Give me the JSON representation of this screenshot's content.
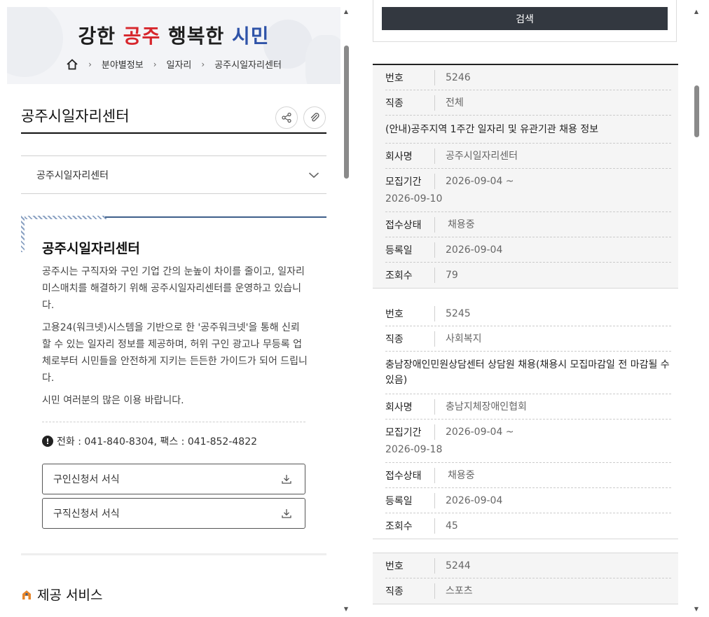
{
  "header": {
    "slogan_part1": "강한 ",
    "slogan_part2": "공주",
    "slogan_part3": " 행복한 ",
    "slogan_part4": "시민",
    "breadcrumb": [
      "분야별정보",
      "일자리",
      "공주시일자리센터"
    ]
  },
  "page": {
    "title": "공주시일자리센터",
    "selectbox_value": "공주시일자리센터"
  },
  "intro": {
    "title": "공주시일자리센터",
    "paragraphs": [
      "공주시는 구직자와 구인 기업 간의 눈높이 차이를 줄이고, 일자리 미스매치를 해결하기 위해 공주시일자리센터를 운영하고 있습니다.",
      "고용24(워크넷)시스템을 기반으로 한 '공주워크넷'을 통해 신뢰할 수 있는 일자리 정보를 제공하며, 허위 구인 광고나 무등록 업체로부터 시민들을 안전하게 지키는 든든한 가이드가 되어 드립니다.",
      "시민 여러분의 많은 이용 바랍니다."
    ],
    "contact": "전화 : 041-840-8304, 팩스 : 041-852-4822"
  },
  "downloads": [
    {
      "label": "구인신청서 서식"
    },
    {
      "label": "구직신청서 서식"
    }
  ],
  "services": {
    "title": "제공 서비스"
  },
  "search": {
    "button_label": "검색"
  },
  "labels": {
    "number": "번호",
    "category": "직종",
    "company": "회사명",
    "period": "모집기간",
    "status": "접수상태",
    "registered": "등록일",
    "views": "조회수"
  },
  "jobs": [
    {
      "number": "5246",
      "category": "전체",
      "title": "(안내)공주지역 1주간 일자리 및 유관기관 채용 정보",
      "company": "공주시일자리센터",
      "period_start": "2026-09-04 ~",
      "period_end": "2026-09-10",
      "status": "채용중",
      "registered": "2026-09-04",
      "views": "79"
    },
    {
      "number": "5245",
      "category": "사회복지",
      "title": "충남장애인민원상담센터 상담원 채용(채용시 모집마감일 전 마감될 수 있음)",
      "company": "충남지체장애인협회",
      "period_start": "2026-09-04 ~",
      "period_end": "2026-09-18",
      "status": "채용중",
      "registered": "2026-09-04",
      "views": "45"
    },
    {
      "number": "5244",
      "category": "스포츠"
    }
  ],
  "colors": {
    "accent_red": "#d7262c",
    "accent_blue": "#2f53a8",
    "search_button": "#333840",
    "intro_line": "#3e5f8a"
  }
}
